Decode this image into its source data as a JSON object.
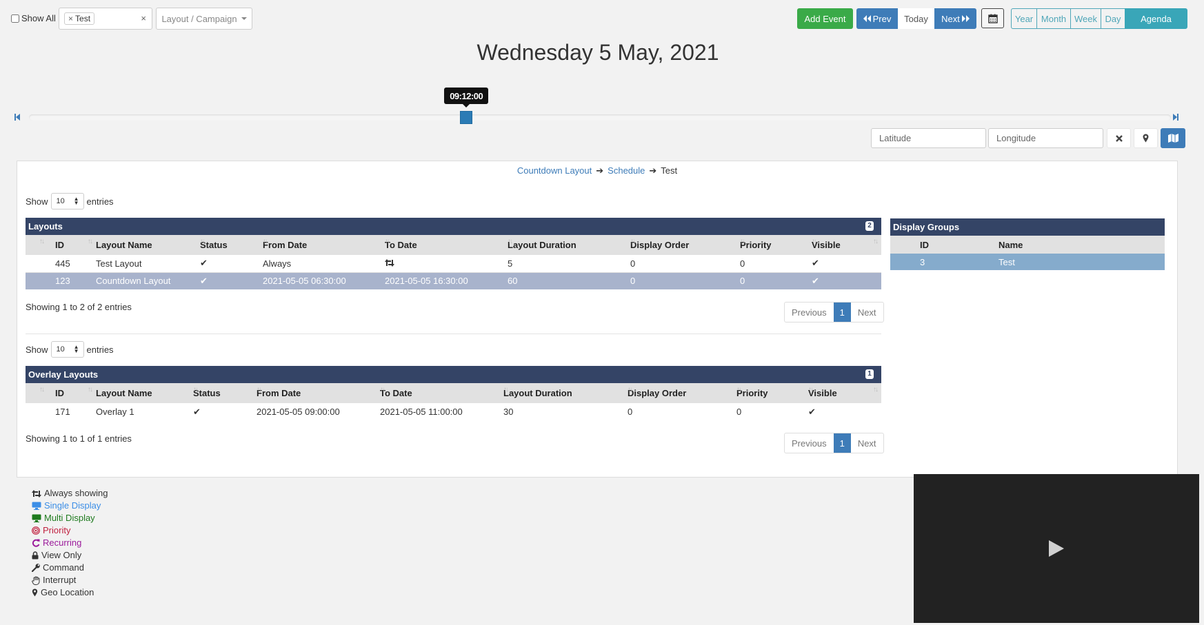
{
  "toolbar": {
    "show_all_label": "Show All",
    "selected_tag": "Test",
    "tag_remove_glyph": "×",
    "tag_clear_glyph": "×",
    "layout_campaign_label": "Layout / Campaign",
    "add_event_label": "Add Event",
    "prev_label": "Prev",
    "today_label": "Today",
    "next_label": "Next",
    "views": [
      "Year",
      "Month",
      "Week",
      "Day",
      "Agenda"
    ],
    "active_view": "Agenda"
  },
  "title": "Wednesday 5 May, 2021",
  "slider": {
    "time_label": "09:12:00",
    "value_fraction": 0.383
  },
  "geo": {
    "latitude_placeholder": "Latitude",
    "longitude_placeholder": "Longitude",
    "latitude_value": "",
    "longitude_value": ""
  },
  "breadcrumb": {
    "items": [
      "Countdown Layout",
      "Schedule",
      "Test"
    ]
  },
  "layouts_table": {
    "show_label": "Show",
    "page_length": "10",
    "entries_label": "entries",
    "title": "Layouts",
    "count": "2",
    "columns": [
      "ID",
      "Layout Name",
      "Status",
      "From Date",
      "To Date",
      "Layout Duration",
      "Display Order",
      "Priority",
      "Visible"
    ],
    "rows": [
      {
        "id": "445",
        "name": "Test Layout",
        "status": "✔",
        "from": "Always",
        "to": "always-showing-icon",
        "duration": "5",
        "order": "0",
        "priority": "0",
        "visible": "✔",
        "selected": false
      },
      {
        "id": "123",
        "name": "Countdown Layout",
        "status": "✔",
        "from": "2021-05-05 06:30:00",
        "to": "2021-05-05 16:30:00",
        "duration": "60",
        "order": "0",
        "priority": "0",
        "visible": "✔",
        "selected": true
      }
    ],
    "info": "Showing 1 to 2 of 2 entries",
    "pager": {
      "previous": "Previous",
      "current": "1",
      "next": "Next"
    }
  },
  "overlay_table": {
    "show_label": "Show",
    "page_length": "10",
    "entries_label": "entries",
    "title": "Overlay Layouts",
    "count": "1",
    "columns": [
      "ID",
      "Layout Name",
      "Status",
      "From Date",
      "To Date",
      "Layout Duration",
      "Display Order",
      "Priority",
      "Visible"
    ],
    "rows": [
      {
        "id": "171",
        "name": "Overlay 1",
        "status": "✔",
        "from": "2021-05-05 09:00:00",
        "to": "2021-05-05 11:00:00",
        "duration": "30",
        "order": "0",
        "priority": "0",
        "visible": "✔"
      }
    ],
    "info": "Showing 1 to 1 of 1 entries",
    "pager": {
      "previous": "Previous",
      "current": "1",
      "next": "Next"
    }
  },
  "display_groups": {
    "title": "Display Groups",
    "columns": [
      "ID",
      "Name"
    ],
    "rows": [
      {
        "id": "3",
        "name": "Test"
      }
    ]
  },
  "legend": [
    {
      "icon": "always-showing-icon",
      "label": "Always showing",
      "color": "#333333"
    },
    {
      "icon": "single-display-icon",
      "label": "Single Display",
      "color": "#3c8ee6"
    },
    {
      "icon": "multi-display-icon",
      "label": "Multi Display",
      "color": "#1e7a1e"
    },
    {
      "icon": "priority-icon",
      "label": "Priority",
      "color": "#c0213f"
    },
    {
      "icon": "recurring-icon",
      "label": "Recurring",
      "color": "#9b1b9b"
    },
    {
      "icon": "lock-icon",
      "label": "View Only",
      "color": "#333333"
    },
    {
      "icon": "wrench-icon",
      "label": "Command",
      "color": "#333333"
    },
    {
      "icon": "hand-icon",
      "label": "Interrupt",
      "color": "#333333"
    },
    {
      "icon": "map-marker-icon",
      "label": "Geo Location",
      "color": "#333333"
    }
  ],
  "colors": {
    "primary": "#3e7cb8",
    "success": "#3aaa48",
    "info": "#39a6b8",
    "table_header": "#344466",
    "selected_row": "#a8b3cc",
    "selected_group_row": "#85abcc"
  }
}
